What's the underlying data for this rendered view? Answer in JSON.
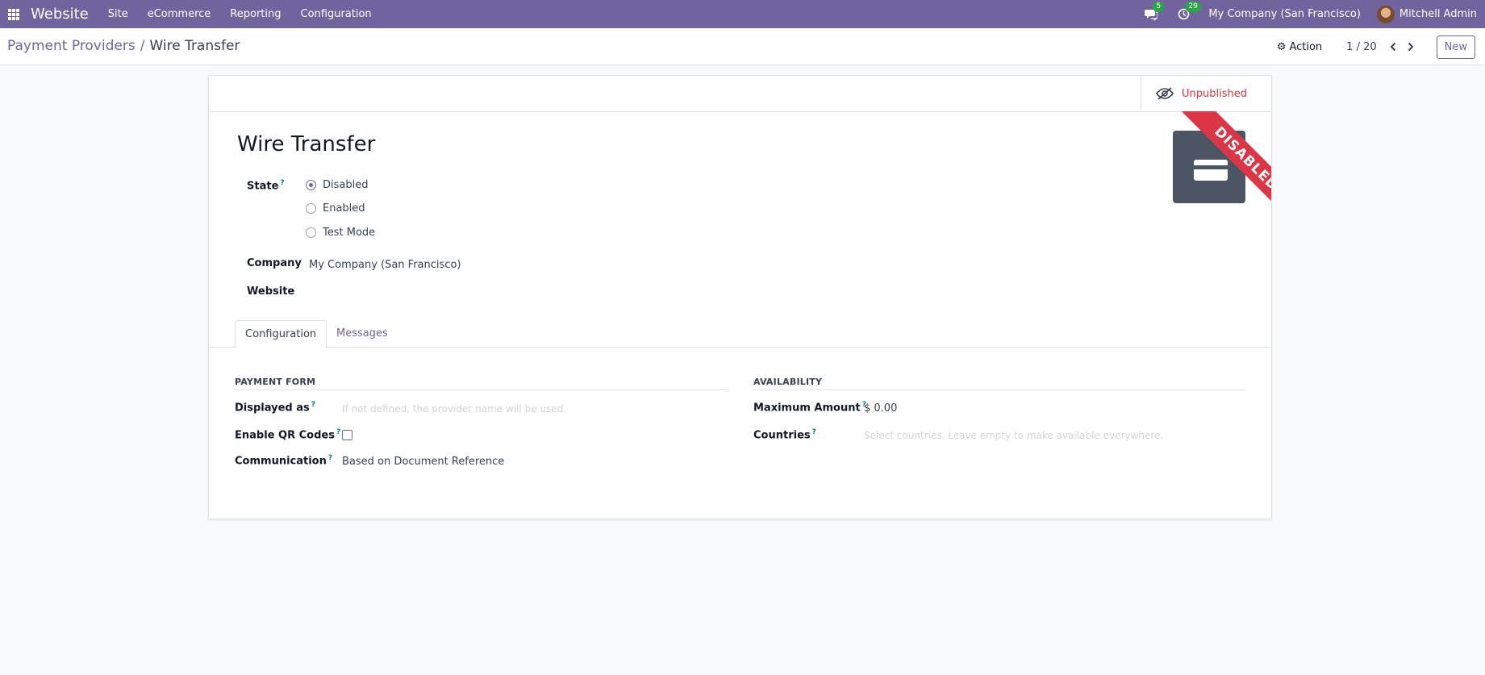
{
  "navbar": {
    "brand": "Website",
    "menu": [
      "Site",
      "eCommerce",
      "Reporting",
      "Configuration"
    ],
    "messages_count": "5",
    "activities_count": "29",
    "company": "My Company (San Francisco)",
    "user": "Mitchell Admin",
    "color": "#71639e"
  },
  "breadcrumb": {
    "parent": "Payment Providers",
    "separator": "/",
    "current": "Wire Transfer"
  },
  "control": {
    "action_label": "Action",
    "pager": "1 / 20",
    "new_label": "New"
  },
  "record": {
    "publish_status": "Unpublished",
    "title": "Wire Transfer",
    "ribbon": "DISABLED",
    "state_label": "State",
    "state_options": [
      "Disabled",
      "Enabled",
      "Test Mode"
    ],
    "state_selected": "Disabled",
    "company_label": "Company",
    "company_value": "My Company (San Francisco)",
    "website_label": "Website",
    "website_value": ""
  },
  "tabs": [
    "Configuration",
    "Messages"
  ],
  "payment_form": {
    "title": "PAYMENT FORM",
    "displayed_as_label": "Displayed as",
    "displayed_as_placeholder": "If not defined, the provider name will be used.",
    "qr_label": "Enable QR Codes",
    "qr_checked": false,
    "communication_label": "Communication",
    "communication_value": "Based on Document Reference"
  },
  "availability": {
    "title": "AVAILABILITY",
    "max_amount_label": "Maximum Amount",
    "max_amount_value": "$ 0.00",
    "countries_label": "Countries",
    "countries_placeholder": "Select countries. Leave empty to make available everywhere."
  },
  "help_mark": "?",
  "colors": {
    "ribbon": "#dc3545",
    "unpublished": "#dc3545",
    "accent": "#71639e"
  }
}
